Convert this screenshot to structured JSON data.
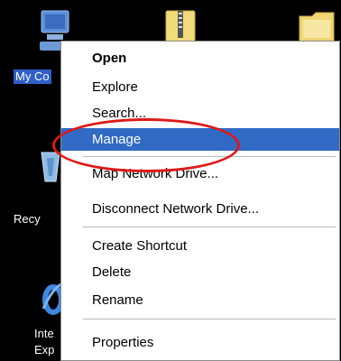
{
  "desktop": {
    "icons": [
      {
        "label": "My Co",
        "selected": true,
        "icon": "my-computer-icon"
      },
      {
        "label": "Recy",
        "icon": "recycle-bin-icon"
      },
      {
        "label": "Inte",
        "label2": "Exp",
        "icon": "internet-explorer-icon"
      },
      {
        "label": "",
        "icon": "folder-zip-icon"
      },
      {
        "label": "",
        "icon": "folder-icon"
      }
    ]
  },
  "context_menu": {
    "items": [
      {
        "label": "Open",
        "bold": true
      },
      {
        "label": "Explore"
      },
      {
        "label": "Search..."
      },
      {
        "label": "Manage",
        "highlighted": true
      },
      {
        "label": "Map Network Drive..."
      },
      {
        "label": "Disconnect Network Drive..."
      },
      {
        "label": "Create Shortcut"
      },
      {
        "label": "Delete"
      },
      {
        "label": "Rename"
      },
      {
        "label": "Properties"
      }
    ]
  },
  "annotation": {
    "color": "#e01818",
    "shape": "ellipse"
  },
  "colors": {
    "highlight": "#316ac5",
    "desktop_bg": "#000000",
    "label_selected": "#2f5fc7"
  }
}
